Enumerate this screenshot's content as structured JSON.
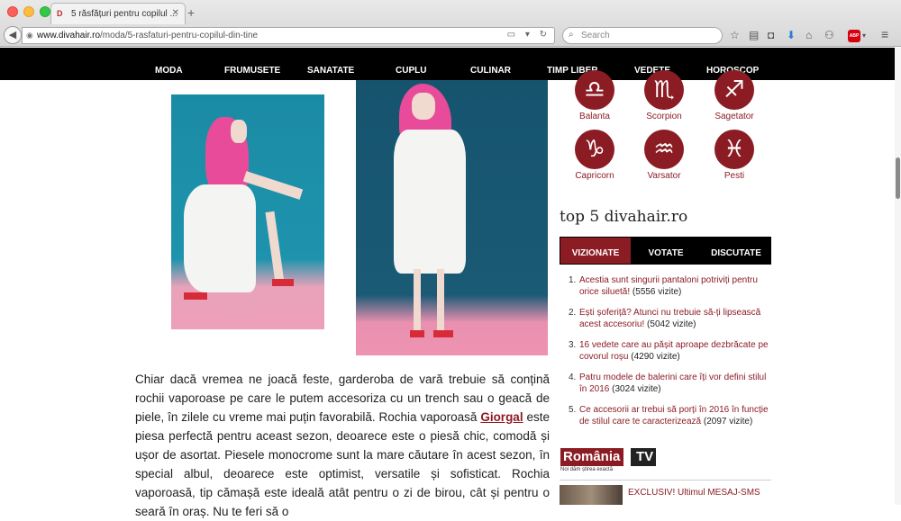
{
  "browser": {
    "tab_title": "5 răsfățuri pentru copilul ...",
    "tab_favicon": "D",
    "new_tab": "+",
    "url_host": "www.divahair.ro",
    "url_path": "/moda/5-rasfaturi-pentru-copilul-din-tine",
    "search_placeholder": "Search",
    "adblock": "ABP"
  },
  "site_nav": [
    "MODA",
    "FRUMUSETE",
    "SANATATE",
    "CUPLU",
    "CULINAR",
    "TIMP LIBER",
    "VEDETE",
    "HOROSCOP"
  ],
  "zodiac": [
    {
      "symbol": "♎",
      "label": "Balanta"
    },
    {
      "symbol": "♏",
      "label": "Scorpion"
    },
    {
      "symbol": "♐",
      "label": "Sagetator"
    },
    {
      "symbol": "♑",
      "label": "Capricorn"
    },
    {
      "symbol": "♒",
      "label": "Varsator"
    },
    {
      "symbol": "♓",
      "label": "Pesti"
    }
  ],
  "top5": {
    "title": "top 5 divahair.ro",
    "tabs": [
      "VIZIONATE",
      "VOTATE",
      "DISCUTATE"
    ],
    "items": [
      {
        "num": "1.",
        "text": "Acestia sunt singurii pantaloni potriviți pentru orice siluetă!",
        "count": "(5556 vizite)"
      },
      {
        "num": "2.",
        "text": "Ești șoferiță? Atunci nu trebuie să-ți lipsească acest accesoriu!",
        "count": "(5042 vizite)"
      },
      {
        "num": "3.",
        "text": "16 vedete care au pășit aproape dezbrăcate pe covorul roșu",
        "count": "(4290 vizite)"
      },
      {
        "num": "4.",
        "text": "Patru modele de balerini care îți vor defini stilul în 2016",
        "count": "(3024 vizite)"
      },
      {
        "num": "5.",
        "text": "Ce accesorii ar trebui să porți în 2016 în funcție de stilul care te caracterizează",
        "count": "(2097 vizite)"
      }
    ]
  },
  "rtv": {
    "word": "România",
    "tv": "TV",
    "slogan": "Noi dăm știrea exactă",
    "news_title": "EXCLUSIV! Ultimul MESAJ-SMS"
  },
  "article": {
    "part1": "Chiar dacă vremea ne joacă feste, garderoba de vară trebuie să conțină rochii vaporoase pe care le putem accesoriza cu un trench sau o geacă de piele, în zilele cu vreme mai puțin favorabilă. Rochia vaporoasă ",
    "link": "Giorgal",
    "part2": " este piesa perfectă pentru aceast sezon, deoarece este o piesă chic, comodă și ușor de asortat. Piesele monocrome sunt la mare căutare în acest sezon, în special albul, deoarece este optimist, versatile și sofisticat. Rochia vaporoasă, tip cămașă este ideală atât pentru o zi de birou, cât și pentru o seară în oraș. Nu te feri să o"
  }
}
